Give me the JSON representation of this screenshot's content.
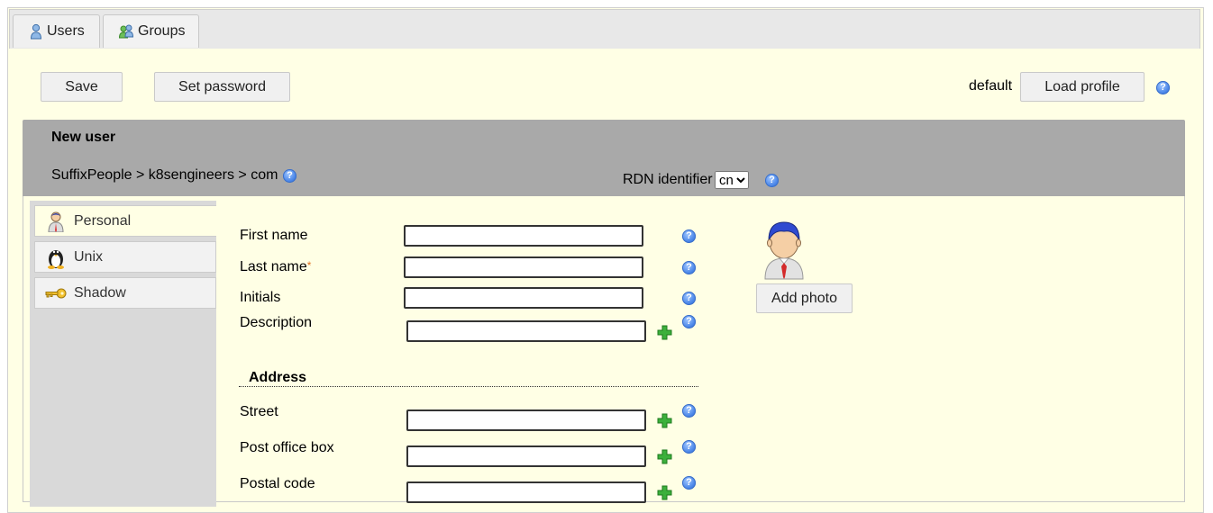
{
  "tabs": [
    {
      "label": "Users",
      "icon": "user-icon"
    },
    {
      "label": "Groups",
      "icon": "groups-icon"
    }
  ],
  "toolbar": {
    "save_label": "Save",
    "set_password_label": "Set password",
    "profile_name": "default",
    "load_profile_label": "Load profile"
  },
  "header": {
    "title": "New user",
    "breadcrumb": "SuffixPeople > k8sengineers > com",
    "rdn_label": "RDN identifier",
    "rdn_value": "cn"
  },
  "side_tabs": [
    {
      "label": "Personal",
      "icon": "person-icon"
    },
    {
      "label": "Unix",
      "icon": "tux-icon"
    },
    {
      "label": "Shadow",
      "icon": "key-icon"
    }
  ],
  "form": {
    "first_name_label": "First name",
    "last_name_label": "Last name",
    "required_mark": "*",
    "initials_label": "Initials",
    "description_label": "Description",
    "address_heading": "Address",
    "street_label": "Street",
    "po_box_label": "Post office box",
    "postal_code_label": "Postal code",
    "add_photo_label": "Add photo"
  },
  "colors": {
    "page_bg": "#ffffe5",
    "header_bg": "#a9a9a9",
    "sidebar_bg": "#d9d9d9",
    "help_icon": "#4a86e8",
    "plus_icon": "#2ea02e",
    "required": "#e07020"
  }
}
